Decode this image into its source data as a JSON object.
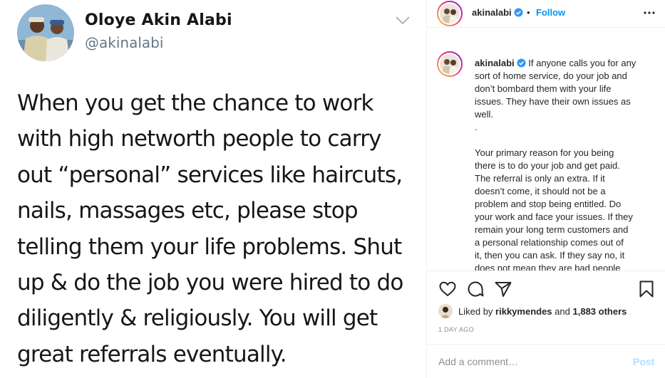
{
  "tweet": {
    "name": "Oloye Akin Alabi",
    "handle": "@akinalabi",
    "lines": [
      "When you get the chance to work",
      "with high networth people to carry",
      "out “personal” services like haircuts,",
      "nails, massages etc, please stop",
      "telling them your life problems. Shut",
      "up & do the job you were hired to do",
      "diligently & religiously. You will get",
      "great referrals eventually."
    ]
  },
  "post": {
    "header": {
      "username": "akinalabi",
      "separator": "•",
      "follow_label": "Follow"
    },
    "caption": {
      "username": "akinalabi",
      "first_line_rest": "If anyone calls you for any",
      "lines_block1": [
        "sort of home service, do your job and",
        "don’t bombard them with your life",
        "issues. They have their own issues as",
        "well.",
        "."
      ],
      "lines_block2": [
        "Your primary reason for you being",
        "there is to do your job and get paid.",
        "The referral is only an extra. If it",
        "doesn’t come, it should not be a",
        "problem and stop being entitled. Do",
        "your work and face your issues. If they",
        "remain your long term customers and",
        "a personal relationship comes out of",
        "it, then you can ask. If they say no, it",
        "does not mean they are bad people"
      ]
    },
    "likes": {
      "prefix": "Liked by",
      "user": "rikkymendes",
      "and": "and",
      "count": "1,883 others"
    },
    "time": "1 DAY AGO",
    "comment": {
      "placeholder": "Add a comment…",
      "post_label": "Post"
    },
    "icons": [
      "heart-icon",
      "comment-icon",
      "share-icon",
      "bookmark-icon",
      "more-icon",
      "verified-icon",
      "chevron-down-icon"
    ],
    "colors": {
      "link": "#0095f6",
      "verified": "#3897f0",
      "muted": "#8e8e8e",
      "post_disabled": "#b2dffc"
    }
  }
}
